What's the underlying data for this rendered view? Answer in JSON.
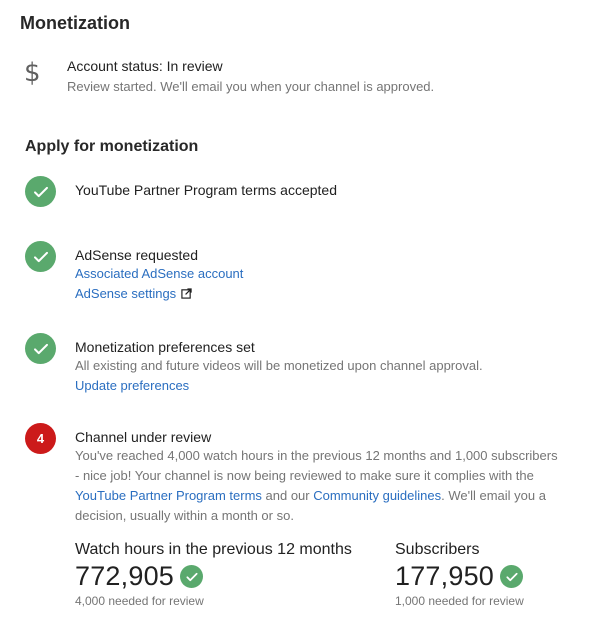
{
  "page": {
    "title": "Monetization"
  },
  "account_status": {
    "icon": "dollar-icon",
    "symbol": "$",
    "title": "Account status: In review",
    "subtitle": "Review started. We'll email you when your channel is approved."
  },
  "apply": {
    "title": "Apply for monetization",
    "steps": [
      {
        "state": "done",
        "title": "YouTube Partner Program terms accepted"
      },
      {
        "state": "done",
        "title": "AdSense requested",
        "links": [
          "Associated AdSense account",
          "AdSense settings"
        ]
      },
      {
        "state": "done",
        "title": "Monetization preferences set",
        "desc": "All existing and future videos will be monetized upon channel approval.",
        "links": [
          "Update preferences"
        ]
      },
      {
        "state": "pending",
        "badge": "4",
        "title": "Channel under review",
        "desc_part1": "You've reached 4,000 watch hours in the previous 12 months and 1,000 subscribers - nice job! Your channel is now being reviewed to make sure it complies with the ",
        "link_terms": "YouTube Partner Program terms",
        "desc_part2": " and our ",
        "link_guidelines": "Community guidelines",
        "desc_part3": ". We'll email you a decision, usually within a month or so."
      }
    ]
  },
  "metrics": {
    "watch_hours": {
      "label": "Watch hours in the previous 12 months",
      "value": "772,905",
      "note": "4,000 needed for review"
    },
    "subscribers": {
      "label": "Subscribers",
      "value": "177,950",
      "note": "1,000 needed for review"
    }
  },
  "colors": {
    "success": "#5aa96d",
    "alert": "#cc1a1a",
    "link": "#2a6ec0"
  }
}
